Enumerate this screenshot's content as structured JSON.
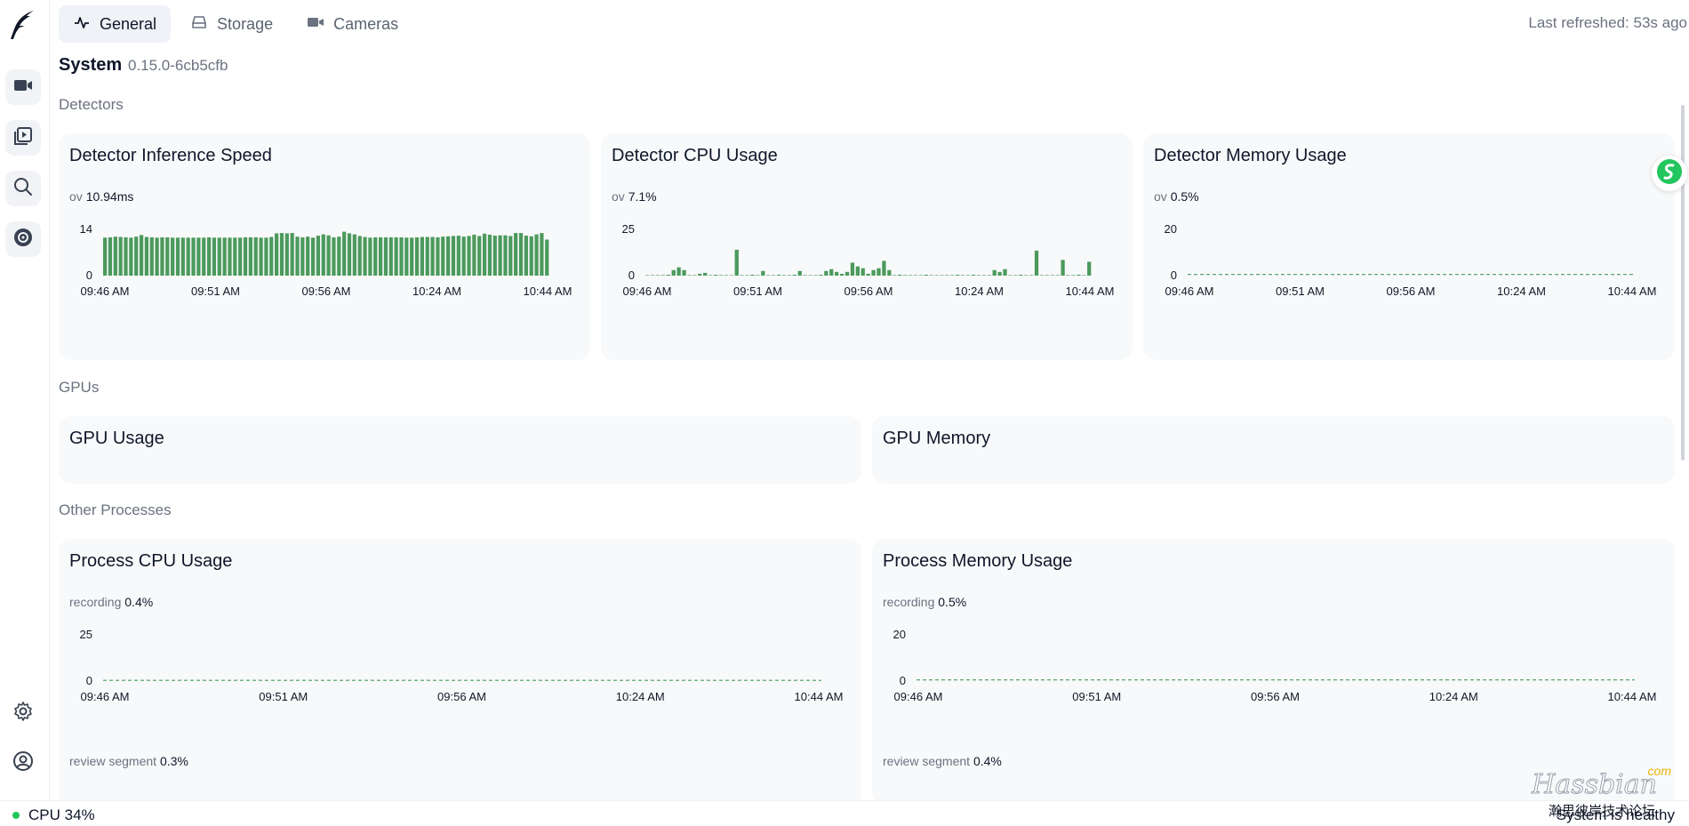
{
  "header": {
    "tabs": [
      {
        "label": "General",
        "icon": "activity-icon",
        "active": true
      },
      {
        "label": "Storage",
        "icon": "hard-drive-icon",
        "active": false
      },
      {
        "label": "Cameras",
        "icon": "video-icon",
        "active": false
      }
    ],
    "last_refreshed": "Last refreshed: 53s ago"
  },
  "system": {
    "title": "System",
    "version": "0.15.0-6cb5cfb"
  },
  "sections": {
    "detectors": "Detectors",
    "gpus": "GPUs",
    "other": "Other Processes"
  },
  "cards": {
    "inference": {
      "title": "Detector Inference Speed",
      "metric_name": "ov",
      "metric_value": "10.94ms"
    },
    "det_cpu": {
      "title": "Detector CPU Usage",
      "metric_name": "ov",
      "metric_value": "7.1%"
    },
    "det_mem": {
      "title": "Detector Memory Usage",
      "metric_name": "ov",
      "metric_value": "0.5%"
    },
    "gpu_usage": {
      "title": "GPU Usage"
    },
    "gpu_mem": {
      "title": "GPU Memory"
    },
    "proc_cpu": {
      "title": "Process CPU Usage",
      "metric_name": "recording",
      "metric_value": "0.4%",
      "metric2_name": "review segment",
      "metric2_value": "0.3%"
    },
    "proc_mem": {
      "title": "Process Memory Usage",
      "metric_name": "recording",
      "metric_value": "0.5%",
      "metric2_name": "review segment",
      "metric2_value": "0.4%"
    }
  },
  "statusbar": {
    "cpu": "CPU 34%",
    "health": "System is healthy"
  },
  "watermark": {
    "main": "Hassbian",
    "com": "com",
    "sub": "瀚思彼岸技术论坛"
  },
  "colors": {
    "bar": "#4b9a5c",
    "accent": "#22c55e"
  },
  "chart_data": [
    {
      "type": "bar",
      "id": "inference",
      "x_ticks": [
        "09:46 AM",
        "09:51 AM",
        "09:56 AM",
        "10:24 AM",
        "10:44 AM"
      ],
      "y_ticks": [
        0,
        14
      ],
      "ylim": [
        0,
        14
      ],
      "values": [
        11.5,
        11.6,
        11.8,
        11.7,
        11.6,
        11.5,
        11.8,
        12.3,
        11.7,
        11.6,
        11.5,
        11.6,
        11.6,
        11.5,
        11.5,
        11.5,
        11.5,
        11.5,
        11.5,
        11.5,
        11.6,
        11.5,
        11.5,
        11.5,
        11.5,
        11.5,
        11.5,
        11.6,
        11.6,
        11.6,
        11.5,
        11.5,
        11.7,
        12.8,
        12.9,
        12.8,
        12.9,
        11.8,
        11.6,
        11.8,
        11.5,
        12.1,
        12.5,
        12.2,
        11.6,
        11.8,
        13.3,
        12.8,
        12.5,
        12.0,
        11.7,
        11.5,
        11.6,
        11.6,
        11.6,
        11.6,
        11.6,
        11.6,
        11.5,
        11.5,
        11.6,
        11.7,
        11.7,
        11.7,
        11.6,
        11.8,
        11.9,
        12.0,
        12.1,
        11.8,
        12.0,
        12.4,
        12.0,
        12.7,
        12.4,
        12.1,
        12.2,
        12.2,
        12.0,
        12.9,
        12.9,
        12.1,
        11.9,
        12.5,
        12.9,
        10.9
      ]
    },
    {
      "type": "bar",
      "id": "det_cpu",
      "x_ticks": [
        "09:46 AM",
        "09:51 AM",
        "09:56 AM",
        "10:24 AM",
        "10:44 AM"
      ],
      "y_ticks": [
        0,
        25
      ],
      "ylim": [
        0,
        25
      ],
      "values": [
        0,
        0,
        0,
        0,
        0.3,
        3,
        4.5,
        3,
        0,
        0,
        1,
        1.5,
        0,
        0.3,
        0,
        0,
        0,
        14,
        0,
        0,
        0.5,
        0,
        2.5,
        0,
        0,
        0.3,
        0,
        0,
        0.5,
        2.5,
        0,
        0,
        0,
        0.3,
        2.5,
        3.5,
        2,
        1,
        2,
        7,
        5,
        4,
        1,
        3,
        4,
        8,
        3,
        0,
        0.5,
        0,
        0,
        0,
        0,
        0.3,
        0,
        0,
        0,
        0,
        0,
        0.3,
        0,
        0,
        0.3,
        0,
        0,
        0,
        3,
        2,
        3.5,
        0,
        0,
        0.3,
        0,
        0,
        13.5,
        0,
        0,
        0,
        0,
        8.5,
        0,
        0,
        0.5,
        0,
        7.5
      ]
    },
    {
      "type": "line",
      "id": "det_mem",
      "x_ticks": [
        "09:46 AM",
        "09:51 AM",
        "09:56 AM",
        "10:24 AM",
        "10:44 AM"
      ],
      "y_ticks": [
        0,
        20
      ],
      "ylim": [
        0,
        20
      ],
      "values": [
        0.5,
        0.5
      ]
    },
    {
      "type": "line",
      "id": "proc_cpu",
      "x_ticks": [
        "09:46 AM",
        "09:51 AM",
        "09:56 AM",
        "10:24 AM",
        "10:44 AM"
      ],
      "y_ticks": [
        0,
        25
      ],
      "ylim": [
        0,
        25
      ],
      "values": [
        0.4,
        0.4
      ]
    },
    {
      "type": "line",
      "id": "proc_mem",
      "x_ticks": [
        "09:46 AM",
        "09:51 AM",
        "09:56 AM",
        "10:24 AM",
        "10:44 AM"
      ],
      "y_ticks": [
        0,
        20
      ],
      "ylim": [
        0,
        20
      ],
      "values": [
        0.5,
        0.5
      ]
    }
  ]
}
